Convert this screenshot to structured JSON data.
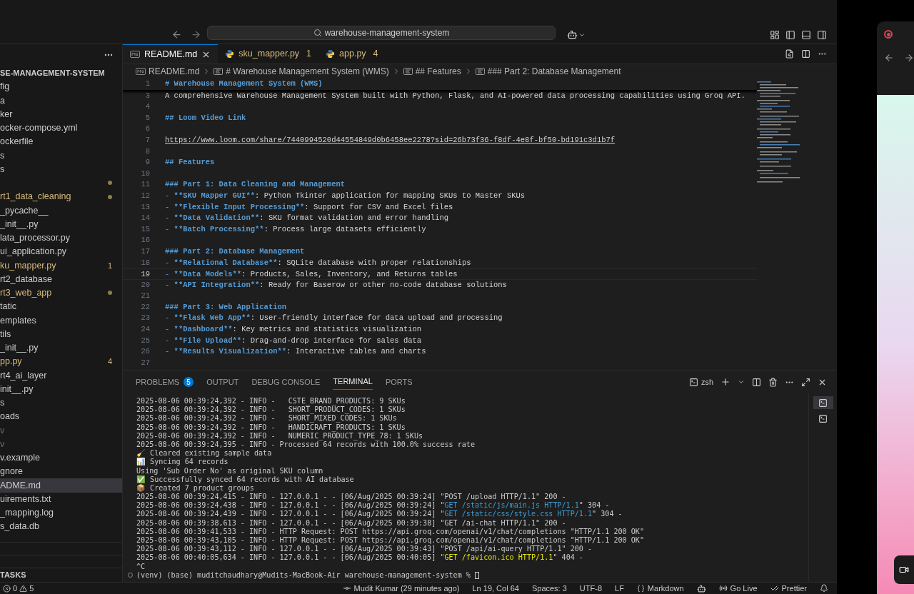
{
  "title_bar": {
    "search": "warehouse-management-system"
  },
  "sidebar": {
    "title": "SE-MANAGEMENT-SYSTEM",
    "items": [
      {
        "label": "fig",
        "selected": false,
        "kind": "normal"
      },
      {
        "label": "a",
        "selected": false,
        "kind": "normal"
      },
      {
        "label": "ker",
        "selected": false,
        "kind": "normal"
      },
      {
        "label": "ocker-compose.yml",
        "selected": false,
        "kind": "normal"
      },
      {
        "label": "ockerfile",
        "selected": false,
        "kind": "normal"
      },
      {
        "label": "s",
        "selected": false,
        "kind": "normal"
      },
      {
        "label": "s",
        "selected": false,
        "kind": "normal"
      },
      {
        "selected": false,
        "kind": "modified",
        "badge": {
          "kind": "dot"
        }
      },
      {
        "label": "rt1_data_cleaning",
        "selected": false,
        "kind": "modified",
        "badge": {
          "kind": "dot"
        }
      },
      {
        "label": "_pycache__",
        "selected": false,
        "kind": "normal"
      },
      {
        "label": "_init__.py",
        "selected": false,
        "kind": "normal"
      },
      {
        "label": "lata_processor.py",
        "selected": false,
        "kind": "normal"
      },
      {
        "label": "ui_application.py",
        "selected": false,
        "kind": "normal"
      },
      {
        "label": "ku_mapper.py",
        "selected": false,
        "kind": "modified",
        "badge": {
          "kind": "count",
          "text": "1"
        }
      },
      {
        "label": "rt2_database",
        "selected": false,
        "kind": "normal"
      },
      {
        "label": "rt3_web_app",
        "selected": false,
        "kind": "modified",
        "badge": {
          "kind": "dot"
        }
      },
      {
        "label": "tatic",
        "selected": false,
        "kind": "normal"
      },
      {
        "label": "emplates",
        "selected": false,
        "kind": "normal"
      },
      {
        "label": "tils",
        "selected": false,
        "kind": "normal"
      },
      {
        "label": "_init__.py",
        "selected": false,
        "kind": "normal"
      },
      {
        "label": "pp.py",
        "selected": false,
        "kind": "modified",
        "badge": {
          "kind": "count",
          "text": "4"
        }
      },
      {
        "label": "rt4_ai_layer",
        "selected": false,
        "kind": "normal"
      },
      {
        "label": "init__.py",
        "selected": false,
        "kind": "normal"
      },
      {
        "label": "s",
        "selected": false,
        "kind": "normal"
      },
      {
        "label": "oads",
        "selected": false,
        "kind": "normal"
      },
      {
        "label": "v",
        "selected": false,
        "kind": "ignored"
      },
      {
        "label": "v",
        "selected": false,
        "kind": "ignored"
      },
      {
        "label": "v.example",
        "selected": false,
        "kind": "normal"
      },
      {
        "label": "gnore",
        "selected": false,
        "kind": "normal"
      },
      {
        "label": "ADME.md",
        "selected": true,
        "kind": "normal"
      },
      {
        "label": "uirements.txt",
        "selected": false,
        "kind": "normal"
      },
      {
        "label": "_mapping.log",
        "selected": false,
        "kind": "normal"
      },
      {
        "label": "s_data.db",
        "selected": false,
        "kind": "normal"
      }
    ],
    "tasks": "TASKS"
  },
  "tabs": [
    {
      "label": "README.md",
      "kind": "markdown",
      "selected": true
    },
    {
      "label": "sku_mapper.py",
      "kind": "python",
      "selected": false,
      "badge": "1"
    },
    {
      "label": "app.py",
      "kind": "python",
      "selected": false,
      "badge": "4"
    }
  ],
  "breadcrumb": [
    {
      "text": "README.md",
      "kind": "file"
    },
    {
      "text": "# Warehouse Management System (WMS)",
      "kind": "symbol"
    },
    {
      "text": "## Features",
      "kind": "symbol"
    },
    {
      "text": "### Part 2: Database Management",
      "kind": "symbol"
    }
  ],
  "sticky_line": {
    "number": "1",
    "segments": [
      {
        "kind": "heading",
        "text": "# Warehouse Management System (WMS)"
      }
    ]
  },
  "lines": [
    {
      "number": "3",
      "current": false,
      "segments": [
        {
          "kind": "text",
          "text": "A comprehensive Warehouse Management System built with Python, Flask, and AI-powered data processing capabilities using Groq API."
        }
      ]
    },
    {
      "number": "4",
      "current": false
    },
    {
      "number": "5",
      "current": false,
      "segments": [
        {
          "kind": "heading",
          "text": "## Loom Video Link"
        }
      ]
    },
    {
      "number": "6",
      "current": false
    },
    {
      "number": "7",
      "current": false,
      "segments": [
        {
          "kind": "link",
          "text": "https://www.loom.com/share/7440994520d44554849d0b6458ee2278?sid=26b73f36-f8df-4e8f-bf50-bd191c3d1b7f"
        }
      ]
    },
    {
      "number": "8",
      "current": false
    },
    {
      "number": "9",
      "current": false,
      "segments": [
        {
          "kind": "heading",
          "text": "## Features"
        }
      ]
    },
    {
      "number": "10",
      "current": false
    },
    {
      "number": "11",
      "current": false,
      "segments": [
        {
          "kind": "heading",
          "text": "### Part 1: Data Cleaning and Management"
        }
      ]
    },
    {
      "number": "12",
      "current": false,
      "segments": [
        {
          "kind": "bullet",
          "text": "- "
        },
        {
          "kind": "bold",
          "text": "**SKU Mapper GUI**"
        },
        {
          "kind": "text",
          "text": ": Python Tkinter application for mapping SKUs to Master SKUs"
        }
      ]
    },
    {
      "number": "13",
      "current": false,
      "segments": [
        {
          "kind": "bullet",
          "text": "- "
        },
        {
          "kind": "bold",
          "text": "**Flexible Input Processing**"
        },
        {
          "kind": "text",
          "text": ": Support for CSV and Excel files"
        }
      ]
    },
    {
      "number": "14",
      "current": false,
      "segments": [
        {
          "kind": "bullet",
          "text": "- "
        },
        {
          "kind": "bold",
          "text": "**Data Validation**"
        },
        {
          "kind": "text",
          "text": ": SKU format validation and error handling"
        }
      ]
    },
    {
      "number": "15",
      "current": false,
      "segments": [
        {
          "kind": "bullet",
          "text": "- "
        },
        {
          "kind": "bold",
          "text": "**Batch Processing**"
        },
        {
          "kind": "text",
          "text": ": Process large datasets efficiently"
        }
      ]
    },
    {
      "number": "16",
      "current": false
    },
    {
      "number": "17",
      "current": false,
      "segments": [
        {
          "kind": "heading",
          "text": "### Part 2: Database Management"
        }
      ]
    },
    {
      "number": "18",
      "current": false,
      "segments": [
        {
          "kind": "bullet",
          "text": "- "
        },
        {
          "kind": "bold",
          "text": "**Relational Database**"
        },
        {
          "kind": "text",
          "text": ": SQLite database with proper relationships"
        }
      ]
    },
    {
      "number": "19",
      "current": true,
      "segments": [
        {
          "kind": "bullet",
          "text": "- "
        },
        {
          "kind": "bold",
          "text": "**Data Models**"
        },
        {
          "kind": "text",
          "text": ": Products, Sales, Inventory, and Returns tables"
        }
      ]
    },
    {
      "number": "20",
      "current": false,
      "segments": [
        {
          "kind": "bullet",
          "text": "- "
        },
        {
          "kind": "bold",
          "text": "**API Integration**"
        },
        {
          "kind": "text",
          "text": ": Ready for Baserow or other no-code database solutions"
        }
      ]
    },
    {
      "number": "21",
      "current": false
    },
    {
      "number": "22",
      "current": false,
      "segments": [
        {
          "kind": "heading",
          "text": "### Part 3: Web Application"
        }
      ]
    },
    {
      "number": "23",
      "current": false,
      "segments": [
        {
          "kind": "bullet",
          "text": "- "
        },
        {
          "kind": "bold",
          "text": "**Flask Web App**"
        },
        {
          "kind": "text",
          "text": ": User-friendly interface for data upload and processing"
        }
      ]
    },
    {
      "number": "24",
      "current": false,
      "segments": [
        {
          "kind": "bullet",
          "text": "- "
        },
        {
          "kind": "bold",
          "text": "**Dashboard**"
        },
        {
          "kind": "text",
          "text": ": Key metrics and statistics visualization"
        }
      ]
    },
    {
      "number": "25",
      "current": false,
      "segments": [
        {
          "kind": "bullet",
          "text": "- "
        },
        {
          "kind": "bold",
          "text": "**File Upload**"
        },
        {
          "kind": "text",
          "text": ": Drag-and-drop interface for sales data"
        }
      ]
    },
    {
      "number": "26",
      "current": false,
      "segments": [
        {
          "kind": "bullet",
          "text": "- "
        },
        {
          "kind": "bold",
          "text": "**Results Visualization**"
        },
        {
          "kind": "text",
          "text": ": Interactive tables and charts"
        }
      ]
    },
    {
      "number": "27",
      "current": false
    }
  ],
  "panel_tabs": [
    {
      "label": "PROBLEMS",
      "selected": false,
      "badge": "5"
    },
    {
      "label": "OUTPUT",
      "selected": false
    },
    {
      "label": "DEBUG CONSOLE",
      "selected": false
    },
    {
      "label": "TERMINAL",
      "selected": true
    },
    {
      "label": "PORTS",
      "selected": false
    }
  ],
  "terminal_name": "zsh",
  "terminal": [
    [
      {
        "kind": "plain",
        "text": "2025-08-06 00:39:24,392 - INFO -   CSTE_BRAND_PRODUCTS: 9 SKUs"
      }
    ],
    [
      {
        "kind": "plain",
        "text": "2025-08-06 00:39:24,392 - INFO -   SHORT_PRODUCT_CODES: 1 SKUs"
      }
    ],
    [
      {
        "kind": "plain",
        "text": "2025-08-06 00:39:24,392 - INFO -   SHORT_MIXED_CODES: 1 SKUs"
      }
    ],
    [
      {
        "kind": "plain",
        "text": "2025-08-06 00:39:24,392 - INFO -   HANDICRAFT_PRODUCTS: 1 SKUs"
      }
    ],
    [
      {
        "kind": "plain",
        "text": "2025-08-06 00:39:24,392 - INFO -   NUMERIC_PRODUCT_TYPE_78: 1 SKUs"
      }
    ],
    [
      {
        "kind": "plain",
        "text": "2025-08-06 00:39:24,395 - INFO - Processed 64 records with 100.0% success rate"
      }
    ],
    [
      {
        "kind": "plain",
        "text": "🧹 Cleared existing sample data"
      }
    ],
    [
      {
        "kind": "plain",
        "text": "📊 Syncing 64 records"
      }
    ],
    [
      {
        "kind": "plain",
        "text": "Using 'Sub Order No' as original SKU column"
      }
    ],
    [
      {
        "kind": "plain",
        "text": "✅ Successfully synced 64 records with AI database"
      }
    ],
    [
      {
        "kind": "plain",
        "text": "📦 Created 7 product groups"
      }
    ],
    [
      {
        "kind": "plain",
        "text": "2025-08-06 00:39:24,415 - INFO - 127.0.0.1 - - [06/Aug/2025 00:39:24] \"POST /upload HTTP/1.1\" 200 -"
      }
    ],
    [
      {
        "kind": "plain",
        "text": "2025-08-06 00:39:24,438 - INFO - 127.0.0.1 - - [06/Aug/2025 00:39:24] \""
      },
      {
        "kind": "path",
        "text": "GET /static/js/main.js HTTP/1.1"
      },
      {
        "kind": "plain",
        "text": "\" 304 -"
      }
    ],
    [
      {
        "kind": "plain",
        "text": "2025-08-06 00:39:24,439 - INFO - 127.0.0.1 - - [06/Aug/2025 00:39:24] \""
      },
      {
        "kind": "path",
        "text": "GET /static/css/style.css HTTP/1.1"
      },
      {
        "kind": "plain",
        "text": "\" 304 -"
      }
    ],
    [
      {
        "kind": "plain",
        "text": "2025-08-06 00:39:38,613 - INFO - 127.0.0.1 - - [06/Aug/2025 00:39:38] \"GET /ai-chat HTTP/1.1\" 200 -"
      }
    ],
    [
      {
        "kind": "plain",
        "text": "2025-08-06 00:39:41,533 - INFO - HTTP Request: POST https://api.groq.com/openai/v1/chat/completions \"HTTP/1.1 200 OK\""
      }
    ],
    [
      {
        "kind": "plain",
        "text": "2025-08-06 00:39:43,105 - INFO - HTTP Request: POST https://api.groq.com/openai/v1/chat/completions \"HTTP/1.1 200 OK\""
      }
    ],
    [
      {
        "kind": "plain",
        "text": "2025-08-06 00:39:43,112 - INFO - 127.0.0.1 - - [06/Aug/2025 00:39:43] \"POST /api/ai-query HTTP/1.1\" 200 -"
      }
    ],
    [
      {
        "kind": "plain",
        "text": "2025-08-06 00:40:05,634 - INFO - 127.0.0.1 - - [06/Aug/2025 00:40:05] \""
      },
      {
        "kind": "warn",
        "text": "GET /favicon.ico HTTP/1.1"
      },
      {
        "kind": "plain",
        "text": "\" 404 -"
      }
    ],
    [
      {
        "kind": "plain",
        "text": "^C"
      }
    ]
  ],
  "prompt": "(venv) (base) muditchaudhary@Mudits-MacBook-Air warehouse-management-system % ",
  "problems_summary": {
    "errors": "0",
    "warnings": "5"
  },
  "status": [
    {
      "kind": "git",
      "text": "Mudit Kumar (29 minutes ago)"
    },
    {
      "kind": "text",
      "text": "Ln 19, Col 64"
    },
    {
      "kind": "text",
      "text": "Spaces: 3"
    },
    {
      "kind": "text",
      "text": "UTF-8"
    },
    {
      "kind": "text",
      "text": "LF"
    },
    {
      "kind": "language",
      "text": "Markdown"
    },
    {
      "kind": "copilot"
    },
    {
      "kind": "live",
      "text": "Go Live"
    },
    {
      "kind": "prettier",
      "text": "Prettier"
    },
    {
      "kind": "bell"
    }
  ]
}
